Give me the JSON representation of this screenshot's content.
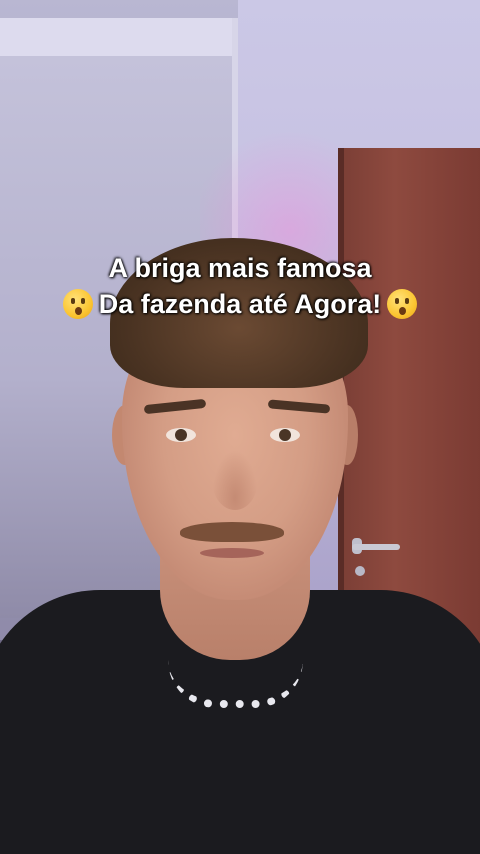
{
  "caption": {
    "line1": "A briga mais famosa",
    "line2": "Da fazenda até Agora!",
    "emoji_left": "astonished-face-emoji",
    "emoji_right": "astonished-face-emoji"
  },
  "scene": {
    "description_colors": {
      "wall": "#c7c2e2",
      "door": "#8e4a3f",
      "shirt": "#1b1b1f"
    }
  }
}
